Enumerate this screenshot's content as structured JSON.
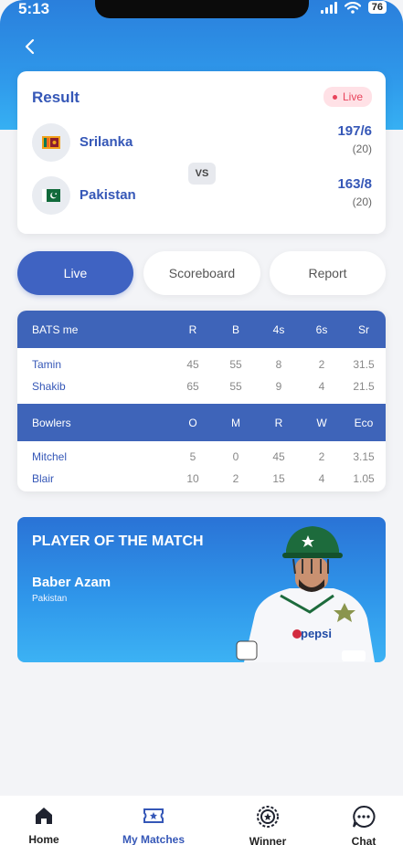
{
  "status_bar": {
    "time": "5:13",
    "battery": "76"
  },
  "result_card": {
    "title": "Result",
    "live_label": "Live",
    "vs_label": "VS",
    "teams": [
      {
        "name": "Srilanka",
        "runs": "197/6",
        "overs": "(20)",
        "flag_icon": "sri-lanka-flag-icon"
      },
      {
        "name": "Pakistan",
        "runs": "163/8",
        "overs": "(20)",
        "flag_icon": "pakistan-flag-icon"
      }
    ]
  },
  "tabs": [
    {
      "label": "Live",
      "active": true
    },
    {
      "label": "Scoreboard",
      "active": false
    },
    {
      "label": "Report",
      "active": false
    }
  ],
  "batting": {
    "headers": [
      "BATS me",
      "R",
      "B",
      "4s",
      "6s",
      "Sr"
    ],
    "rows": [
      [
        "Tamin",
        "45",
        "55",
        "8",
        "2",
        "31.5"
      ],
      [
        "Shakib",
        "65",
        "55",
        "9",
        "4",
        "21.5"
      ]
    ]
  },
  "bowling": {
    "headers": [
      "Bowlers",
      "O",
      "M",
      "R",
      "W",
      "Eco"
    ],
    "rows": [
      [
        "Mitchel",
        "5",
        "0",
        "45",
        "2",
        "3.15"
      ],
      [
        "Blair",
        "10",
        "2",
        "15",
        "4",
        "1.05"
      ]
    ]
  },
  "player_of_match": {
    "title": "PLAYER OF THE MATCH",
    "name": "Baber Azam",
    "country": "Pakistan",
    "jersey_text": "pepsi"
  },
  "bottom_nav": [
    {
      "label": "Home",
      "icon": "home-icon",
      "active": false
    },
    {
      "label": "My Matches",
      "icon": "ticket-icon",
      "active": true
    },
    {
      "label": "Winner",
      "icon": "medal-icon",
      "active": false
    },
    {
      "label": "Chat",
      "icon": "chat-icon",
      "active": false
    }
  ],
  "colors": {
    "primary": "#3e64b9",
    "accent": "#3557b7",
    "live": "#e8445c",
    "hero": "#2f96ea"
  }
}
